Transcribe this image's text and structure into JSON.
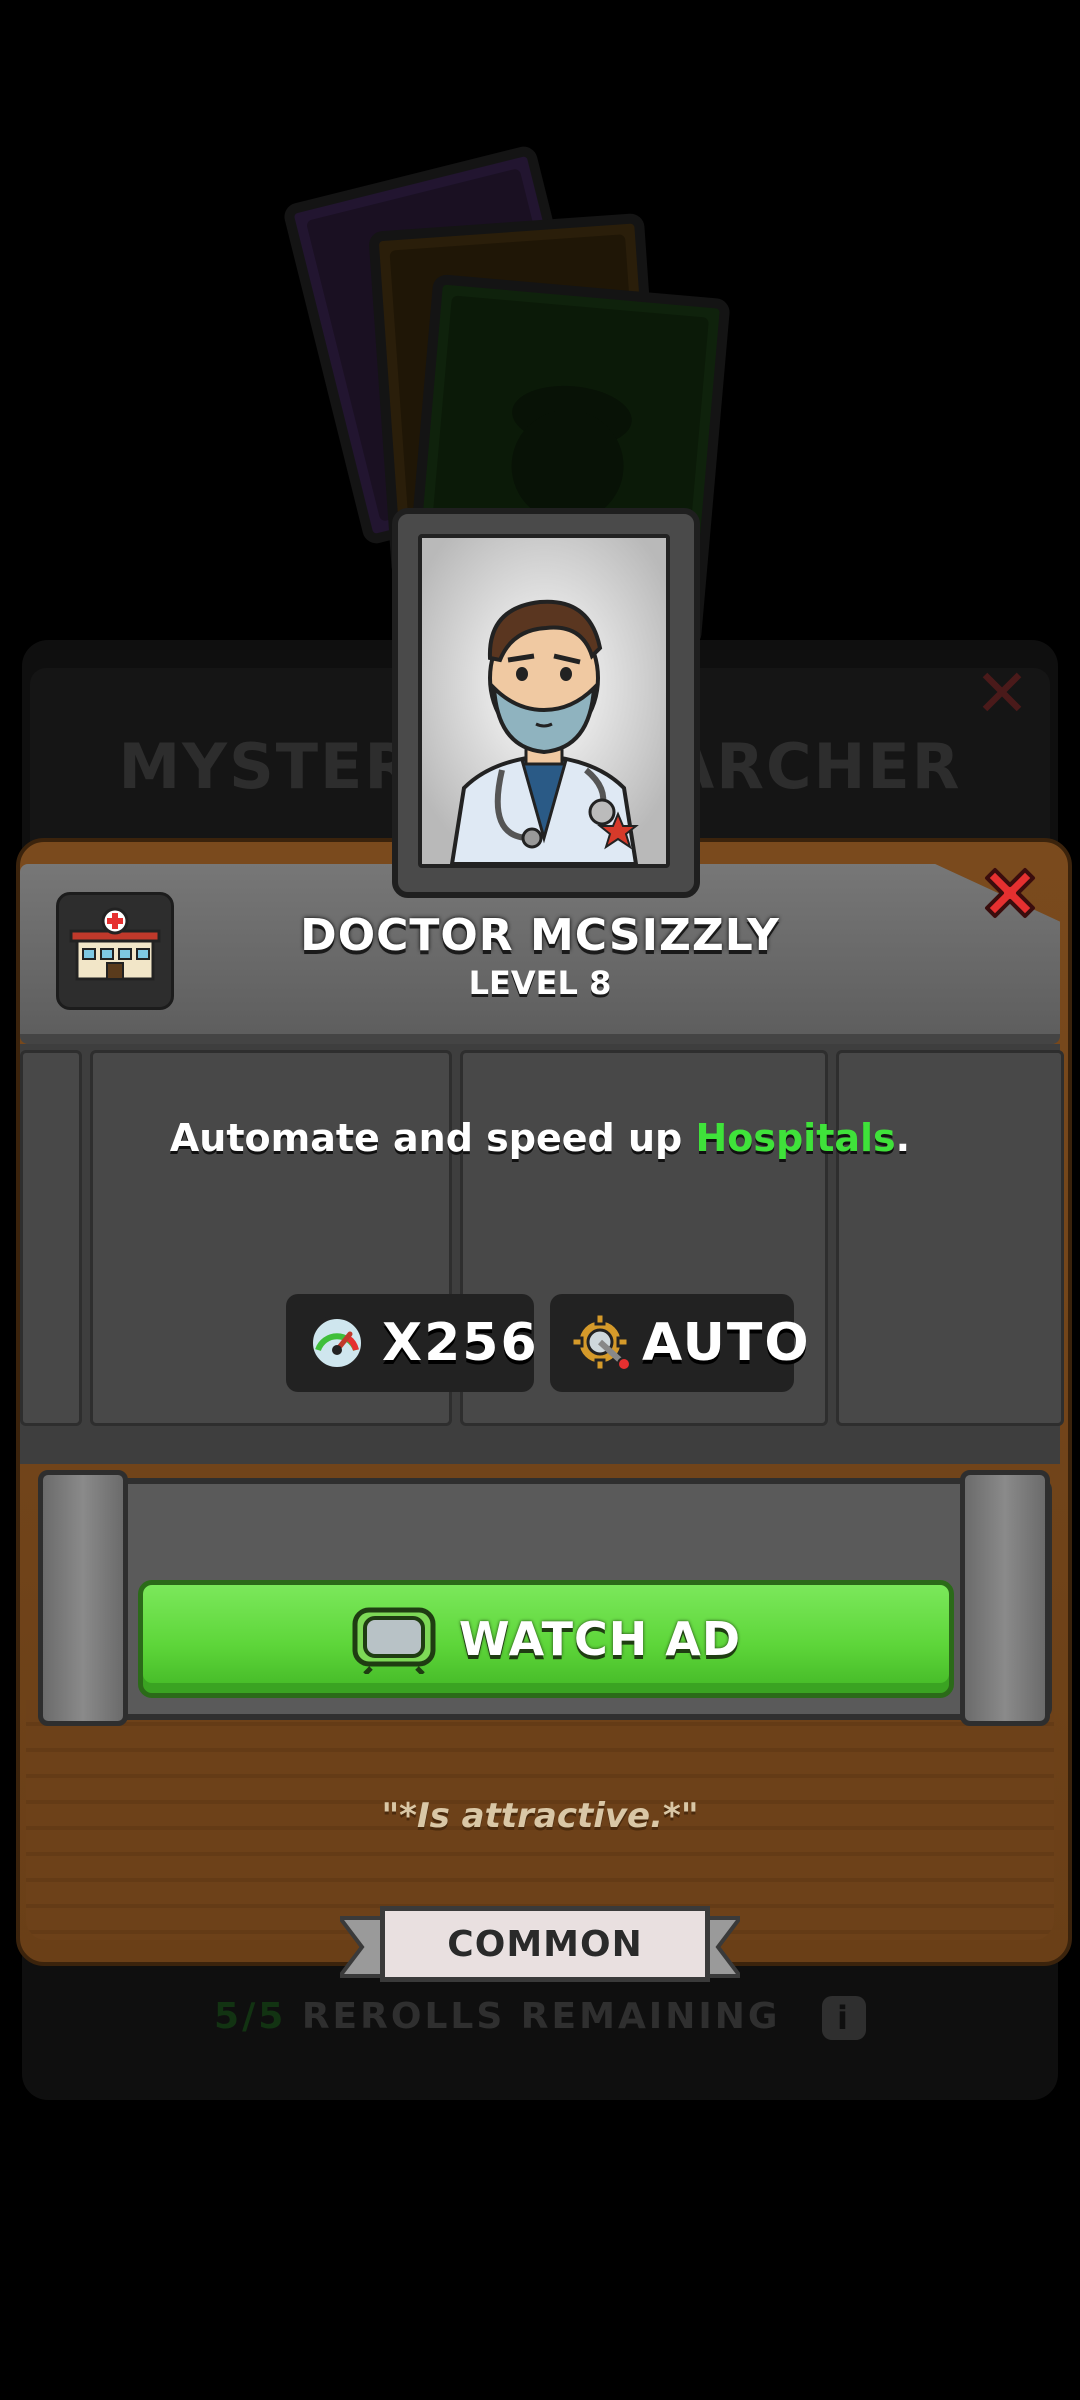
{
  "background": {
    "title": "MYSTERY RESEARCHER",
    "rerolls_count": "5/5",
    "rerolls_label": "REROLLS REMAINING",
    "info_icon": "info-icon"
  },
  "card": {
    "name": "DOCTOR MCSIZZLY",
    "level": "LEVEL 8",
    "building_icon": "hospital-icon",
    "description_before": "Automate and speed up ",
    "description_highlight": "Hospitals",
    "description_after": ".",
    "stats": [
      {
        "icon": "speedometer-icon",
        "value": "X256"
      },
      {
        "icon": "gear-auto-icon",
        "value": "AUTO"
      }
    ],
    "watch_ad_label": "WATCH AD",
    "quote": "\"*Is attractive.*\"",
    "rarity": "COMMON"
  },
  "colors": {
    "highlight": "#3fe23a",
    "button_green": "#5ed63a",
    "close_red": "#e53030",
    "wood": "#7a4a1d"
  }
}
